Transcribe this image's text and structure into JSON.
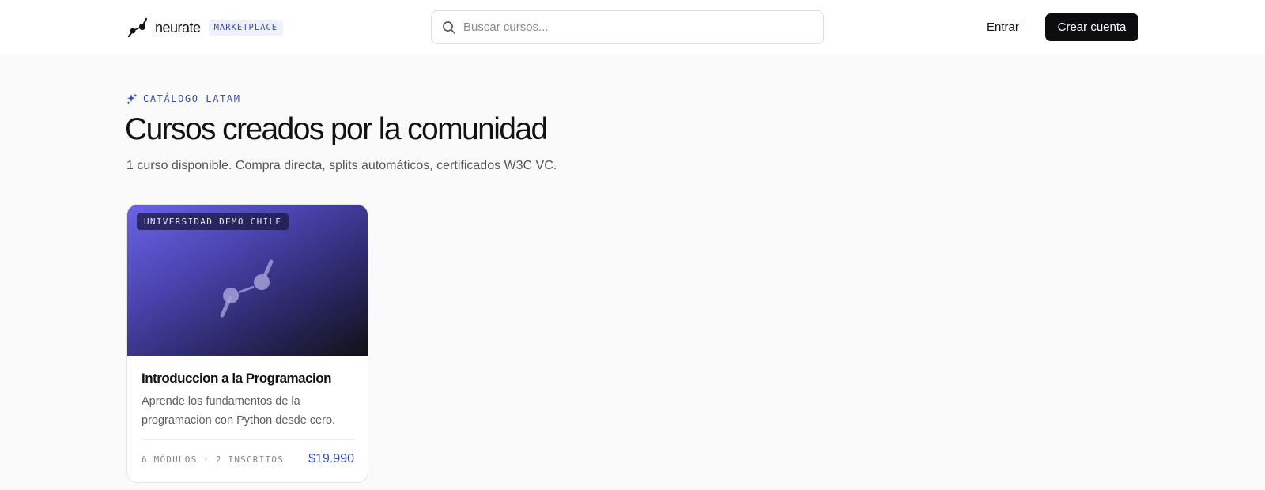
{
  "header": {
    "brand_name": "neurate",
    "brand_badge": "MARKETPLACE",
    "search": {
      "placeholder": "Buscar cursos...",
      "value": ""
    },
    "login_label": "Entrar",
    "signup_label": "Crear cuenta",
    "icons": {
      "logo": "neurate-logo-icon",
      "search": "search-icon"
    }
  },
  "hero": {
    "eyebrow": "CATÁLOGO LATAM",
    "eyebrow_icon": "sparkles-icon",
    "title": "Cursos creados por la comunidad",
    "subtitle": "1 curso disponible. Compra directa, splits automáticos, certificados W3C VC."
  },
  "courses": [
    {
      "org": "UNIVERSIDAD DEMO CHILE",
      "title": "Introduccion a la Programacion",
      "description": "Aprende los fundamentos de la programacion con Python desde cero.",
      "meta": "6 MÓDULOS · 2 INSCRITOS",
      "price": "$19.990",
      "cover_icon": "neurate-logo-icon"
    }
  ],
  "colors": {
    "accent": "#3b4cb0",
    "price": "#3148b8",
    "primary_button": "#0d0d10",
    "cover_gradient": [
      "#6a64e6",
      "#2b2866",
      "#111116"
    ]
  }
}
